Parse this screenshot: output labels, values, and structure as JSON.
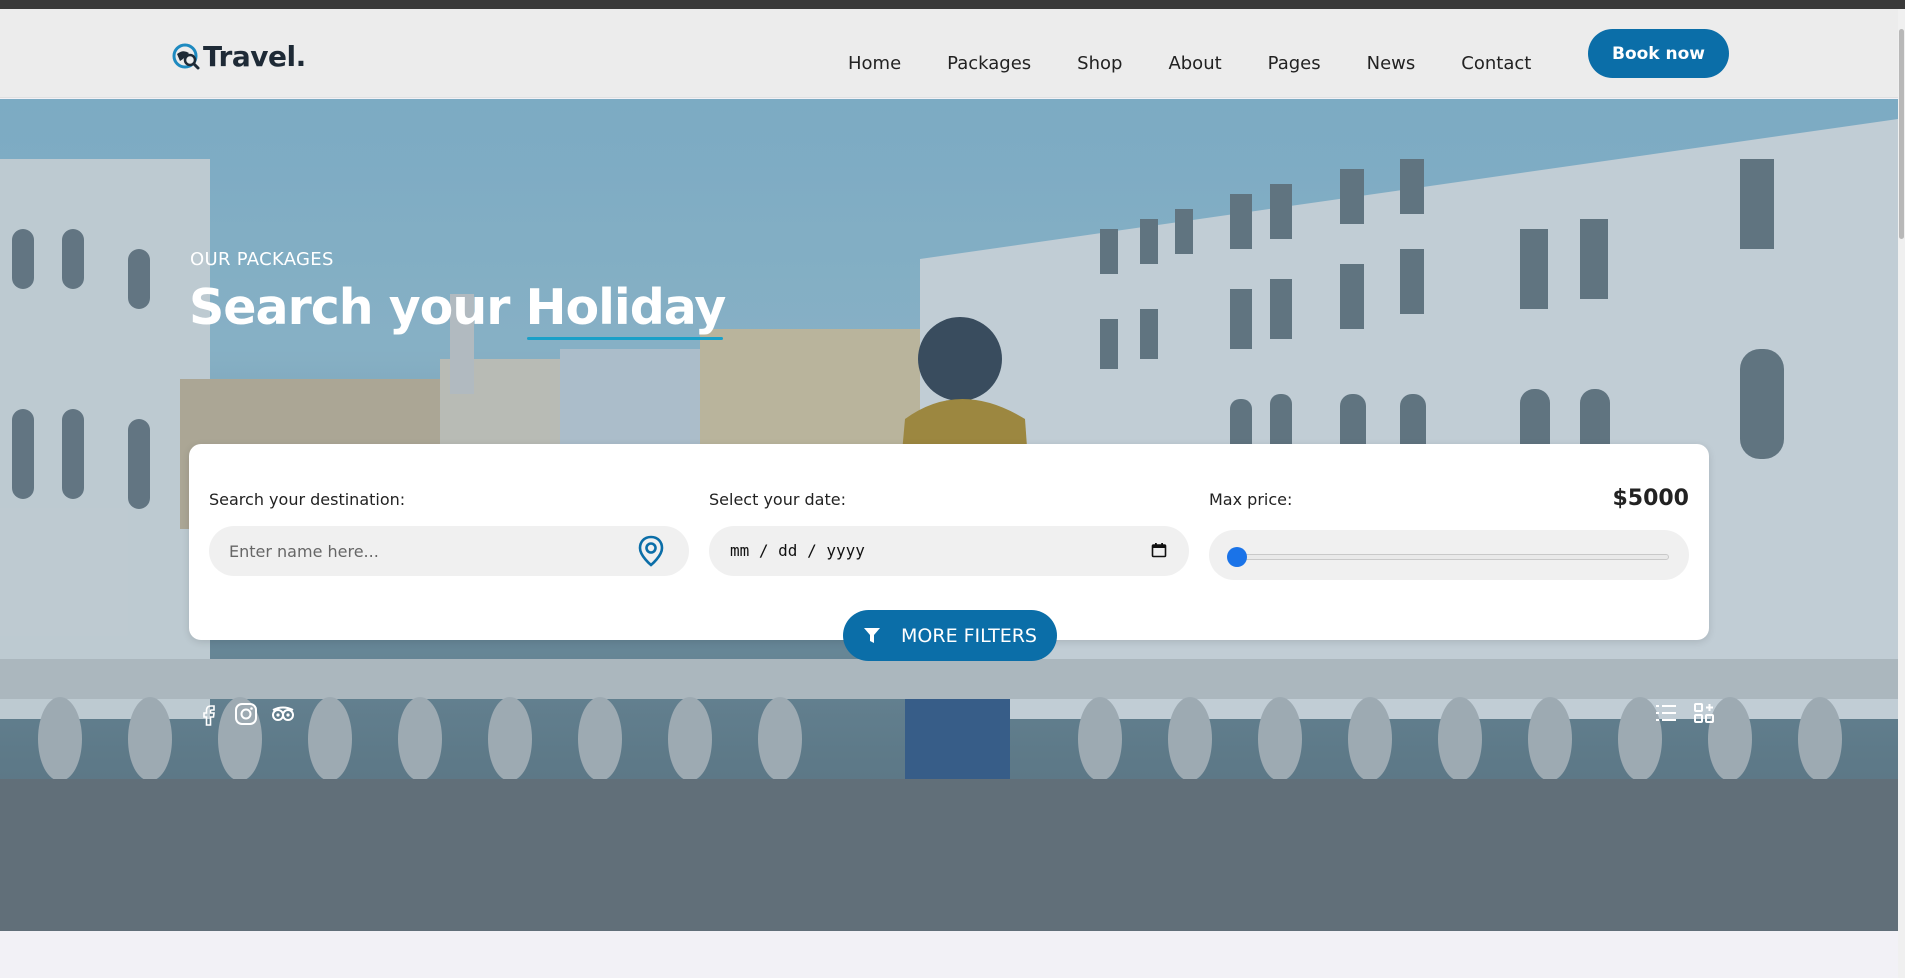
{
  "brand": {
    "name": "Travel."
  },
  "nav": {
    "items": [
      "Home",
      "Packages",
      "Shop",
      "About",
      "Pages",
      "News",
      "Contact"
    ],
    "cta_label": "Book now"
  },
  "hero": {
    "eyebrow": "OUR PACKAGES",
    "title_prefix": "Search your ",
    "title_accent": "Holiday"
  },
  "search": {
    "destination_label": "Search your destination:",
    "destination_placeholder": "Enter name here...",
    "date_label": "Select your date:",
    "date_value": "mm / dd / yyyy",
    "price_label": "Max price:",
    "price_value": "$5000",
    "price_slider_fraction": 0.0,
    "more_filters_label": "MORE FILTERS"
  },
  "icons": {
    "social": [
      "facebook-icon",
      "instagram-icon",
      "tripadvisor-icon"
    ],
    "view": [
      "list-view-icon",
      "grid-view-icon"
    ]
  },
  "colors": {
    "accent": "#0b6ea8",
    "accent_underline": "#1aa0c8",
    "logo": "#1e2a36",
    "slider": "#1a73e8"
  }
}
